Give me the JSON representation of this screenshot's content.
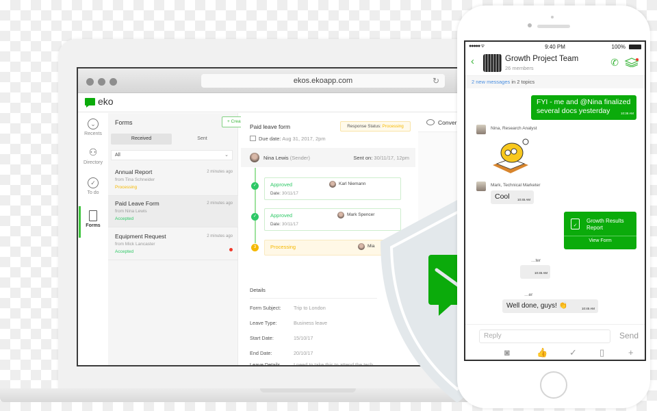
{
  "browser": {
    "url": "ekos.ekoapp.com"
  },
  "app": {
    "logo_text": "eko",
    "brand_color": "#0bab0b"
  },
  "nav": {
    "items": [
      {
        "label": "Recents",
        "icon": "clock-icon"
      },
      {
        "label": "Directory",
        "icon": "people-icon"
      },
      {
        "label": "To do",
        "icon": "check-circle-icon"
      },
      {
        "label": "Forms",
        "icon": "document-icon",
        "active": true
      }
    ]
  },
  "forms": {
    "title": "Forms",
    "create_button": "+ Create Form",
    "tabs": [
      "Received",
      "Sent"
    ],
    "active_tab": "Received",
    "filter_value": "All",
    "filter_chevron": "⌄",
    "items": [
      {
        "title": "Annual Report",
        "time": "2 minutes ago",
        "from": "from Tina Schneider",
        "status": "Processing",
        "status_color": "#f5b800"
      },
      {
        "title": "Paid Leave Form",
        "time": "2 minutes ago",
        "from": "from Nina Lewis",
        "status": "Accepted",
        "status_color": "#2ec866",
        "selected": true
      },
      {
        "title": "Equipment Request",
        "time": "2 minutes ago",
        "from": "from Mick Lancaster",
        "status": "Accepted",
        "status_color": "#2ec866",
        "unread": true
      }
    ]
  },
  "detail": {
    "title": "Paid leave form",
    "response_status_label": "Response Status:",
    "response_status_value": "Processing",
    "due_label": "Due date:",
    "due_value": "Aug 31, 2017, 2pm",
    "sender_name": "Nina Lewis",
    "sender_role": "(Sender)",
    "sent_on_label": "Sent on:",
    "sent_on_value": "30/11/17, 12pm",
    "steps": [
      {
        "marker": "✓",
        "label": "Approved",
        "person": "Karl Niemann",
        "date_label": "Date:",
        "date": "30/11/17"
      },
      {
        "marker": "✓",
        "label": "Approved",
        "person": "Mark Spencer",
        "date_label": "Date:",
        "date": "30/11/17"
      },
      {
        "marker": "3",
        "label": "Processing",
        "person": "Mia"
      }
    ],
    "details_heading": "Details",
    "fields": [
      {
        "key": "Form Subject:",
        "value": "Trip to London"
      },
      {
        "key": "Leave Type:",
        "value": "Business leave"
      },
      {
        "key": "Start Date:",
        "value": "15/10/17"
      },
      {
        "key": "End Date:",
        "value": "20/10/17"
      },
      {
        "key": "Leave  Details (Please give a good reasons also provide",
        "value": "I need to take this to attend the tech conference with Matt, I briefly mentioned it last month."
      }
    ]
  },
  "conversation": {
    "title": "Conver"
  },
  "phone": {
    "signal": "●●●●● ",
    "wifi": "ᯤ",
    "time": "9:40 PM",
    "battery": "100%",
    "back": "‹",
    "group_name": "Growth Project Team",
    "members": "26 members",
    "call_icon": "✆",
    "new_messages_link": "2 new messages",
    "new_messages_rest": " in 2 topics",
    "messages": [
      {
        "type": "out",
        "text": "FYI - me and @Nina finalized several docs yesterday",
        "time": "10:38 AM"
      },
      {
        "type": "sticker",
        "author": "Nina, Research Analyst"
      },
      {
        "type": "in",
        "author": "Mark, Technical Marketer",
        "text": "Cool",
        "time": "10:45 AM"
      },
      {
        "type": "form",
        "title": "Growth Results Report",
        "action": "View Form"
      },
      {
        "type": "in",
        "author": "…ter",
        "text": "",
        "time": "10:45 AM"
      },
      {
        "type": "in",
        "author": "…er",
        "text": "Well done, guys! 👏",
        "time": "10:45 AM"
      }
    ],
    "compose_placeholder": "Reply",
    "send_label": "Send",
    "tools": [
      "camera-icon",
      "thumbs-up-icon",
      "check-icon",
      "document-icon",
      "plus-icon"
    ],
    "tool_glyphs": [
      "◙",
      "👍",
      "✓",
      "▯",
      "+"
    ]
  }
}
